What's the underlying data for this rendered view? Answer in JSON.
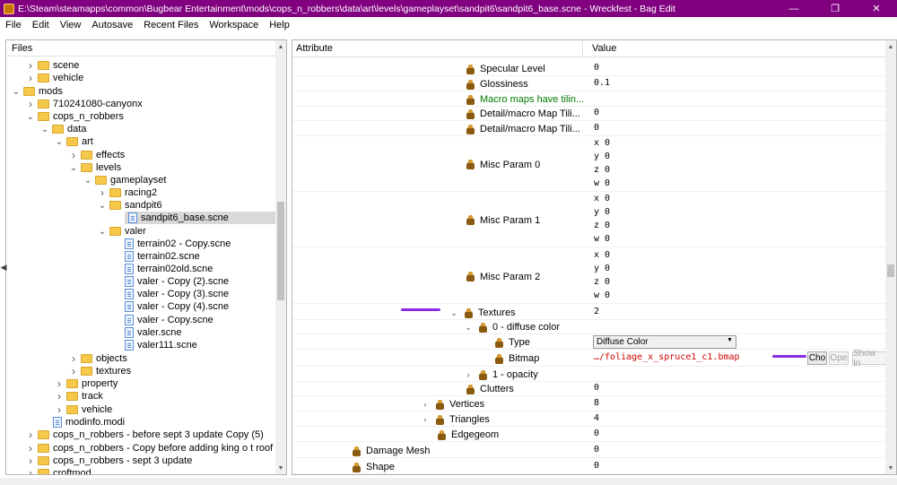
{
  "window": {
    "title": "E:\\Steam\\steamapps\\common\\Bugbear Entertainment\\mods\\cops_n_robbers\\data\\art\\levels\\gameplayset\\sandpit6\\sandpit6_base.scne - Wreckfest - Bag Edit",
    "minimize": "—",
    "maximize": "❐",
    "close": "✕"
  },
  "menu": [
    "File",
    "Edit",
    "View",
    "Autosave",
    "Recent Files",
    "Workspace",
    "Help"
  ],
  "files_pane": {
    "header": "Files",
    "items": [
      {
        "label": "scene",
        "type": "folder",
        "depth": 1,
        "expanded": false
      },
      {
        "label": "vehicle",
        "type": "folder",
        "depth": 1,
        "expanded": false
      },
      {
        "label": "mods",
        "type": "folder",
        "depth": 0,
        "expanded": true
      },
      {
        "label": "710241080-canyonx",
        "type": "folder",
        "depth": 1,
        "expanded": false
      },
      {
        "label": "cops_n_robbers",
        "type": "folder",
        "depth": 1,
        "expanded": true
      },
      {
        "label": "data",
        "type": "folder",
        "depth": 2,
        "expanded": true
      },
      {
        "label": "art",
        "type": "folder",
        "depth": 3,
        "expanded": true
      },
      {
        "label": "effects",
        "type": "folder",
        "depth": 4,
        "expanded": false
      },
      {
        "label": "levels",
        "type": "folder",
        "depth": 4,
        "expanded": true
      },
      {
        "label": "gameplayset",
        "type": "folder",
        "depth": 5,
        "expanded": true
      },
      {
        "label": "racing2",
        "type": "folder",
        "depth": 6,
        "expanded": false
      },
      {
        "label": "sandpit6",
        "type": "folder",
        "depth": 6,
        "expanded": true
      },
      {
        "label": "sandpit6_base.scne",
        "type": "file",
        "depth": 7,
        "selected": true
      },
      {
        "label": "valer",
        "type": "folder",
        "depth": 6,
        "expanded": true
      },
      {
        "label": "terrain02 - Copy.scne",
        "type": "file",
        "depth": 7
      },
      {
        "label": "terrain02.scne",
        "type": "file",
        "depth": 7
      },
      {
        "label": "terrain02old.scne",
        "type": "file",
        "depth": 7
      },
      {
        "label": "valer - Copy (2).scne",
        "type": "file",
        "depth": 7
      },
      {
        "label": "valer - Copy (3).scne",
        "type": "file",
        "depth": 7
      },
      {
        "label": "valer - Copy (4).scne",
        "type": "file",
        "depth": 7
      },
      {
        "label": "valer - Copy.scne",
        "type": "file",
        "depth": 7
      },
      {
        "label": "valer.scne",
        "type": "file",
        "depth": 7
      },
      {
        "label": "valer111.scne",
        "type": "file",
        "depth": 7
      },
      {
        "label": "objects",
        "type": "folder",
        "depth": 4,
        "expanded": false
      },
      {
        "label": "textures",
        "type": "folder",
        "depth": 4,
        "expanded": false
      },
      {
        "label": "property",
        "type": "folder",
        "depth": 3,
        "expanded": false
      },
      {
        "label": "track",
        "type": "folder",
        "depth": 3,
        "expanded": false
      },
      {
        "label": "vehicle",
        "type": "folder",
        "depth": 3,
        "expanded": false
      },
      {
        "label": "modinfo.modi",
        "type": "file",
        "depth": 2
      },
      {
        "label": "cops_n_robbers - before sept 3 update Copy (5)",
        "type": "folder",
        "depth": 1,
        "expanded": false
      },
      {
        "label": "cops_n_robbers - Copy before adding king o t roof",
        "type": "folder",
        "depth": 1,
        "expanded": false
      },
      {
        "label": "cops_n_robbers - sept 3 update",
        "type": "folder",
        "depth": 1,
        "expanded": false
      },
      {
        "label": "croftmod",
        "type": "folder",
        "depth": 1,
        "expanded": false
      }
    ]
  },
  "props_pane": {
    "header_attribute": "Attribute",
    "header_value": "Value",
    "rows": [
      {
        "label": "Specular Level",
        "indent": 193,
        "values": [
          "0"
        ]
      },
      {
        "label": "Glossiness",
        "indent": 193,
        "values": [
          "0.1"
        ]
      },
      {
        "label": "Macro maps have tilin...",
        "indent": 193,
        "values": [],
        "green": true
      },
      {
        "label": "Detail/macro Map Tili...",
        "indent": 193,
        "values": [
          "0"
        ]
      },
      {
        "label": "Detail/macro Map Tili...",
        "indent": 193,
        "values": [
          "0"
        ]
      },
      {
        "label": "Misc Param 0",
        "indent": 193,
        "values": [
          "x 0",
          "y 0",
          "z 0",
          "w 0"
        ]
      },
      {
        "label": "Misc Param 1",
        "indent": 193,
        "values": [
          "x 0",
          "y 0",
          "z 0",
          "w 0"
        ]
      },
      {
        "label": "Misc Param 2",
        "indent": 193,
        "values": [
          "x 0",
          "y 0",
          "z 0",
          "w 0"
        ]
      },
      {
        "label": "Textures",
        "indent": 193,
        "values": [
          "2"
        ],
        "chev": "down"
      },
      {
        "label": "0 - diffuse color",
        "indent": 209,
        "values": [],
        "chev": "down"
      },
      {
        "label": "Type",
        "indent": 225,
        "values": [],
        "select": "Diffuse Color"
      },
      {
        "label": "Bitmap",
        "indent": 225,
        "values": [
          "…/foliage_x_spruce1_c1.bmap"
        ],
        "red": true,
        "buttons": [
          "Cho",
          "Ope",
          "Show In"
        ]
      },
      {
        "label": "1 - opacity",
        "indent": 209,
        "values": [],
        "chev": "right"
      },
      {
        "label": "Clutters",
        "indent": 193,
        "values": [
          "0"
        ]
      },
      {
        "label": "Vertices",
        "indent": 161,
        "values": [
          "8"
        ],
        "chev": "right"
      },
      {
        "label": "Triangles",
        "indent": 161,
        "values": [
          "4"
        ],
        "chev": "right"
      },
      {
        "label": "Edgegeom",
        "indent": 161,
        "values": [
          "0"
        ]
      },
      {
        "label": "Damage Mesh",
        "indent": 66,
        "values": [
          "0"
        ]
      },
      {
        "label": "Shape",
        "indent": 66,
        "values": [
          "0"
        ]
      }
    ]
  },
  "colors": {
    "titlebar": "#800080",
    "annotation_mark": "#8a2be2",
    "bitmap_text": "#d00000",
    "green_text": "#007a00"
  }
}
